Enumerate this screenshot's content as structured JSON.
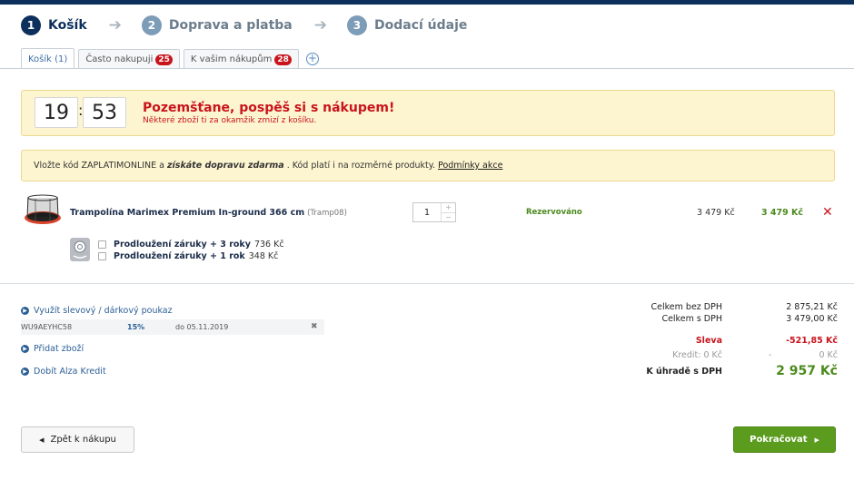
{
  "steps": [
    {
      "num": "1",
      "label": "Košík"
    },
    {
      "num": "2",
      "label": "Doprava a platba"
    },
    {
      "num": "3",
      "label": "Dodací údaje"
    }
  ],
  "tabs": {
    "cart": "Košík (1)",
    "frequent": "Často nakupuji",
    "frequent_count": "25",
    "purchases": "K vašim nákupům",
    "purchases_count": "28"
  },
  "timer": {
    "minutes": "19",
    "seconds": "53",
    "title": "Pozemšťane, pospěš si s nákupem!",
    "subtitle": "Některé zboží ti za okamžik zmizí z košíku."
  },
  "promo": {
    "text_a": "Vložte kód ZAPLATIMONLINE a",
    "bold": "získáte dopravu zdarma",
    "text_b": ". Kód platí i na rozměrné produkty.",
    "link": "Podmínky akce"
  },
  "product": {
    "name": "Trampolína Marimex Premium In-ground 366 cm",
    "code": "(Tramp08)",
    "quantity": "1",
    "status": "Rezervováno",
    "unit_price": "3 479 Kč",
    "total_price": "3 479 Kč"
  },
  "warranties": [
    {
      "label": "Prodloužení záruky + 3 roky",
      "price": "736 Kč"
    },
    {
      "label": "Prodloužení záruky + 1 rok",
      "price": "348 Kč"
    }
  ],
  "left_links": {
    "voucher": "Využít slevový / dárkový poukaz",
    "add_goods": "Přidat zboží",
    "credit": "Dobít Alza Kredit"
  },
  "coupon": {
    "code": "WU9AEYHC58",
    "percent": "15%",
    "valid": "do 05.11.2019"
  },
  "summary": {
    "without_vat_label": "Celkem bez DPH",
    "without_vat": "2 875,21 Kč",
    "with_vat_label": "Celkem s DPH",
    "with_vat": "3 479,00 Kč",
    "discount_label": "Sleva",
    "discount": "-521,85 Kč",
    "credit_label": "Kredit: 0 Kč",
    "credit_dash": "-",
    "credit": "0 Kč",
    "to_pay_label": "K úhradě s DPH",
    "to_pay": "2 957 Kč"
  },
  "buttons": {
    "back": "Zpět k nákupu",
    "next": "Pokračovat"
  },
  "colors": {
    "navy": "#0d2f5c",
    "red": "#c9141c",
    "green": "#5b9c1e",
    "notice_bg": "#fdf5d0"
  }
}
